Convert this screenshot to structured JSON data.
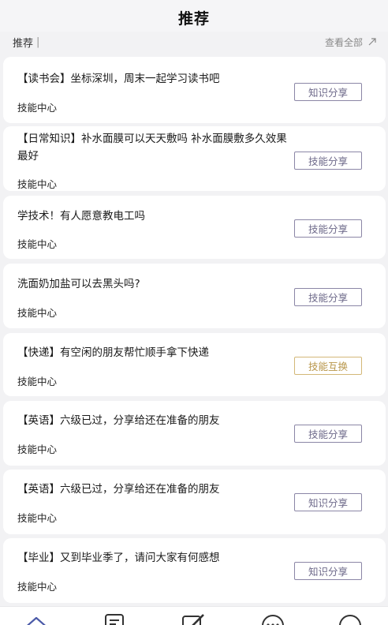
{
  "header": {
    "title": "推荐"
  },
  "subbar": {
    "left_label": "推荐",
    "separator": "|",
    "right_label": "查看全部"
  },
  "cards": [
    {
      "text": "【读书会】坐标深圳，周末一起学习读书吧",
      "category": "技能中心",
      "tag": "知识分享",
      "tag_style": "purple"
    },
    {
      "text": "【日常知识】补水面膜可以天天敷吗 补水面膜敷多久效果最好",
      "category": "技能中心",
      "tag": "技能分享",
      "tag_style": "purple"
    },
    {
      "text": "学技术！有人愿意教电工吗",
      "category": "技能中心",
      "tag": "技能分享",
      "tag_style": "purple"
    },
    {
      "text": "洗面奶加盐可以去黑头吗?",
      "category": "技能中心",
      "tag": "技能分享",
      "tag_style": "purple"
    },
    {
      "text": "【快递】有空闲的朋友帮忙顺手拿下快递",
      "category": "技能中心",
      "tag": "技能互换",
      "tag_style": "gold"
    },
    {
      "text": "【英语】六级已过，分享给还在准备的朋友",
      "category": "技能中心",
      "tag": "技能分享",
      "tag_style": "purple"
    },
    {
      "text": "【英语】六级已过，分享给还在准备的朋友",
      "category": "技能中心",
      "tag": "知识分享",
      "tag_style": "purple"
    },
    {
      "text": "【毕业】又到毕业季了，请问大家有何感想",
      "category": "技能中心",
      "tag": "知识分享",
      "tag_style": "purple"
    }
  ],
  "tabbar": {
    "icons": [
      "home-icon",
      "list-icon",
      "edit-icon",
      "message-icon",
      "profile-icon"
    ]
  },
  "colors": {
    "tag_purple": "#8b86a6",
    "tag_gold": "#d3b878",
    "background": "#f2f2f4"
  }
}
